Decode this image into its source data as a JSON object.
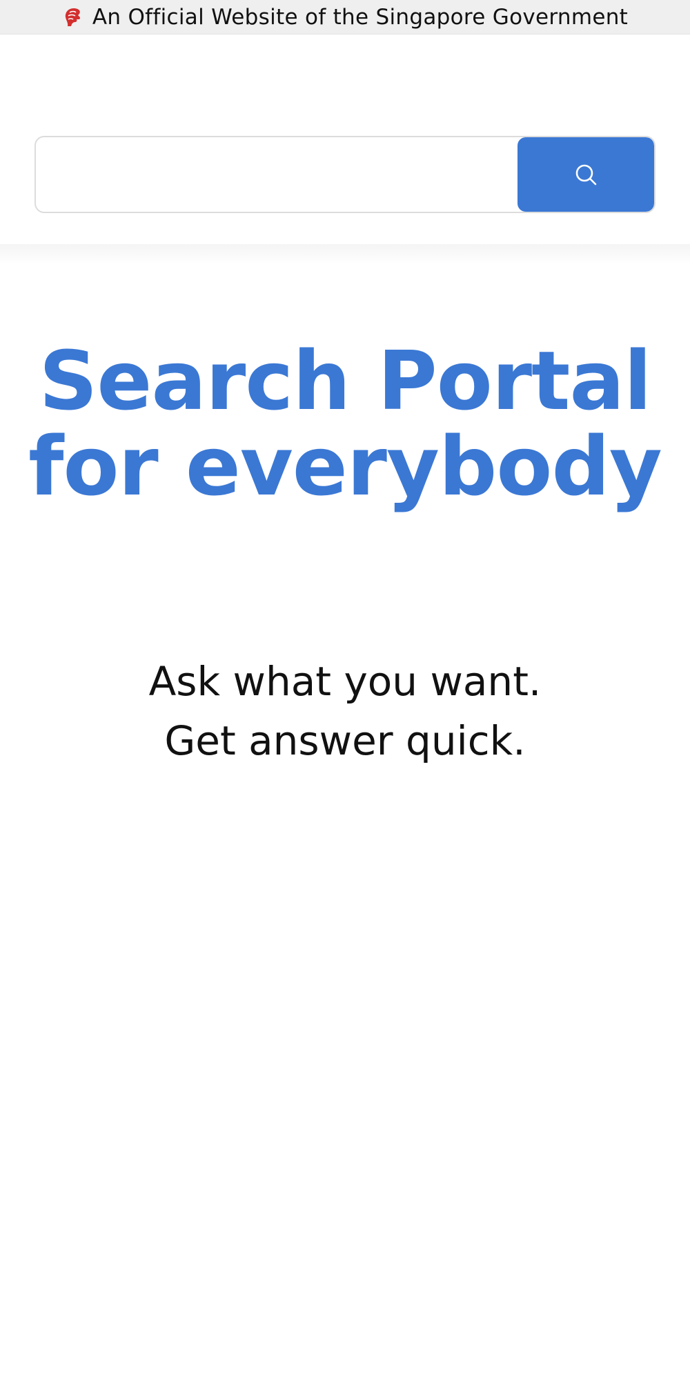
{
  "masthead": {
    "icon": "singapore-lion-head-icon",
    "text": "An Official Website of the Singapore Government",
    "background_color": "#efefef",
    "icon_color": "#d32f2f"
  },
  "search": {
    "input_value": "",
    "button_icon": "search-icon",
    "button_color": "#3b78d4"
  },
  "hero": {
    "title_line1": "Search Portal",
    "title_line2": "for everybody",
    "title_color": "#3b78d4"
  },
  "tagline": {
    "line1": "Ask what you want.",
    "line2": "Get answer quick."
  }
}
